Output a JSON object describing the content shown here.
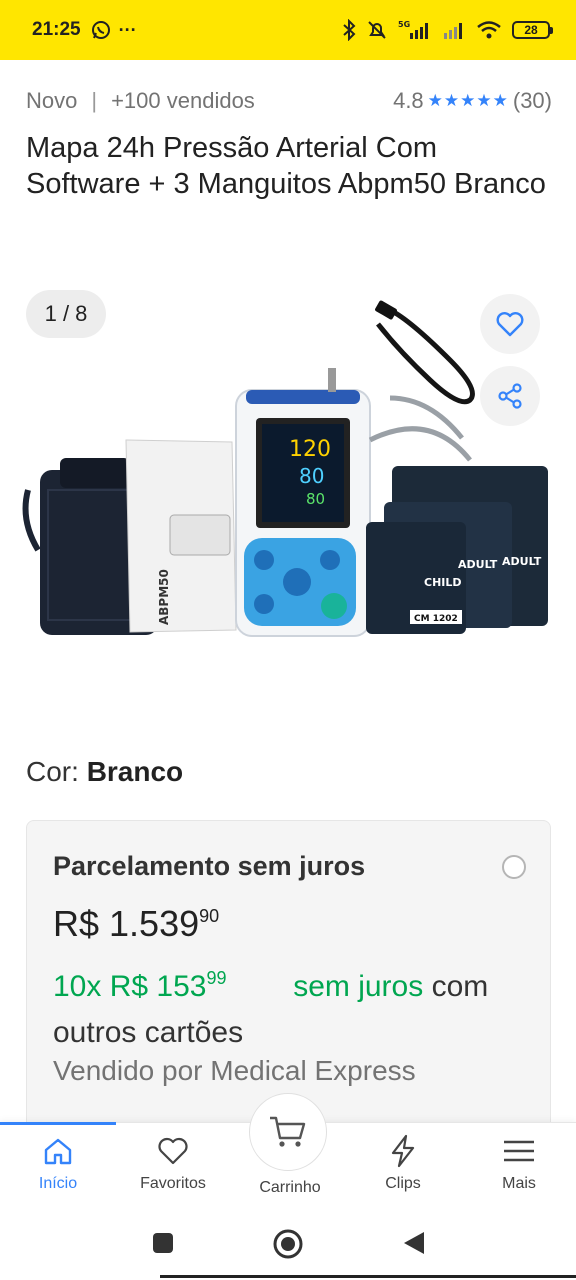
{
  "status_bar": {
    "time": "21:25",
    "battery": "28"
  },
  "product": {
    "condition": "Novo",
    "sold": "+100 vendidos",
    "rating": "4.8",
    "review_count": "(30)",
    "title": "Mapa 24h Pressão Arterial Com Software + 3 Manguitos Abpm50 Branco"
  },
  "gallery": {
    "counter": "1 / 8",
    "device_readings": [
      "120",
      "80",
      "80"
    ],
    "manual_text": "ABPM50",
    "cuff_labels": [
      "CHILD",
      "ADULT",
      "ADULT"
    ],
    "cuff_code": "CM 1202"
  },
  "color": {
    "label": "Cor:",
    "value": "Branco"
  },
  "installments": {
    "heading": "Parcelamento sem juros",
    "price_int": "R$ 1.539",
    "price_cents": "90",
    "count": "10x",
    "inst_int": "R$ 153",
    "inst_cents": "99",
    "no_interest": "sem juros",
    "suffix": "com outros cartões",
    "seller": "Vendido por Medical Express"
  },
  "nav": {
    "home": "Início",
    "favorites": "Favoritos",
    "cart": "Carrinho",
    "clips": "Clips",
    "more": "Mais"
  },
  "colors": {
    "accent": "#3483fa",
    "brand_yellow": "#ffe600",
    "green": "#00a650"
  }
}
